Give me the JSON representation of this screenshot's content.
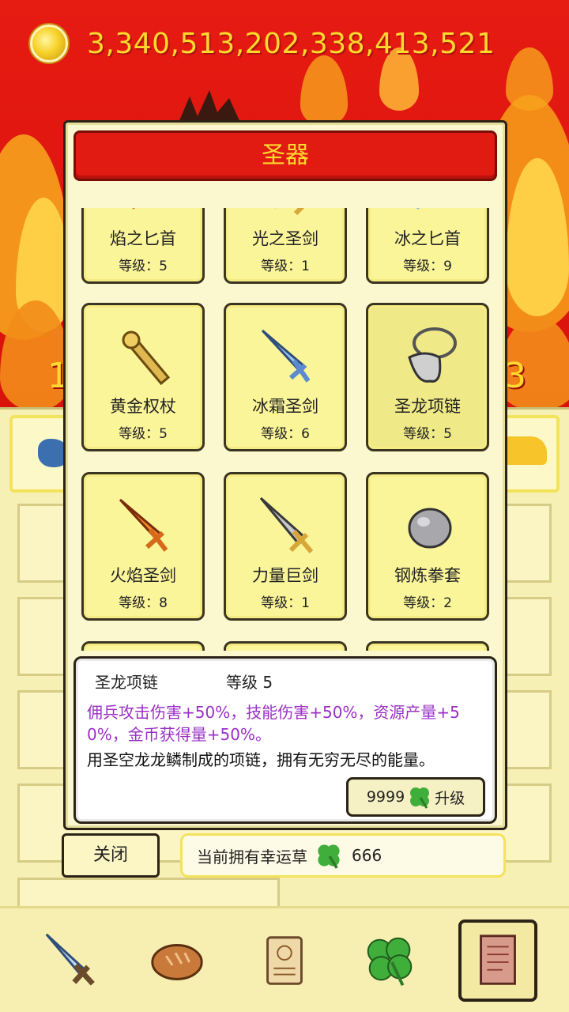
{
  "header": {
    "gold_amount": "3,340,513,202,338,413,521",
    "left_num": "1",
    "right_num": "3"
  },
  "dialog": {
    "title": "圣器",
    "artifacts": [
      {
        "name": "焰之匕首",
        "level_label": "等级：5",
        "icon": "flame-dagger-icon"
      },
      {
        "name": "光之圣剑",
        "level_label": "等级：1",
        "icon": "light-sword-icon"
      },
      {
        "name": "冰之匕首",
        "level_label": "等级：9",
        "icon": "ice-dagger-icon"
      },
      {
        "name": "黄金权杖",
        "level_label": "等级：5",
        "icon": "golden-scepter-icon"
      },
      {
        "name": "冰霜圣剑",
        "level_label": "等级：6",
        "icon": "frost-sword-icon"
      },
      {
        "name": "圣龙项链",
        "level_label": "等级：5",
        "icon": "dragon-necklace-icon",
        "selected": true
      },
      {
        "name": "火焰圣剑",
        "level_label": "等级：8",
        "icon": "flame-sword-icon"
      },
      {
        "name": "力量巨剑",
        "level_label": "等级：1",
        "icon": "greatsword-icon"
      },
      {
        "name": "钢炼拳套",
        "level_label": "等级：2",
        "icon": "steel-gauntlet-icon"
      }
    ],
    "detail": {
      "name": "圣龙项链",
      "level_text": "等级  5",
      "effect": "佣兵攻击伤害+50%，技能伤害+50%，资源产量+50%，金币获得量+50%。",
      "description": "用圣空龙龙鳞制成的项链，拥有无穷无尽的能量。",
      "upgrade_cost": "9999",
      "upgrade_label": "升级"
    },
    "close_label": "关闭",
    "clover_label": "当前拥有幸运草",
    "clover_count": "666"
  },
  "nav": {
    "items": [
      "sword-icon",
      "bread-icon",
      "scroll-icon",
      "clover-icon",
      "book-icon"
    ],
    "active": "book-icon"
  },
  "colors": {
    "title_red": "#e11a12",
    "gold_text": "#ffd92e",
    "effect_purple": "#9a2fc6",
    "card_yellow": "#fbf59a"
  }
}
